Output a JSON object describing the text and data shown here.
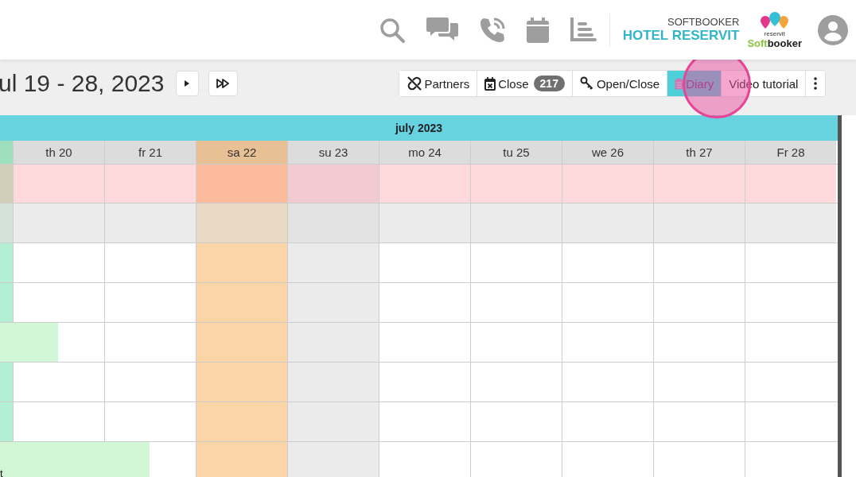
{
  "header": {
    "brand_top": "SOFTBOOKER",
    "brand_name": "HOTEL RESERVIT",
    "logo": {
      "small": "reservit",
      "first": "Soft",
      "second": "booker"
    }
  },
  "toolbar": {
    "period": "ul 19 - 28, 2023",
    "tabs": [
      {
        "label": "Partners",
        "selected": false
      },
      {
        "label": "Close",
        "badge": "217",
        "selected": false
      },
      {
        "label": "Open/Close",
        "selected": false
      },
      {
        "label": "Diary",
        "selected": true
      },
      {
        "label": "Video tutorial",
        "selected": false
      }
    ],
    "click_highlight": true
  },
  "calendar": {
    "month": "july 2023",
    "days": [
      {
        "label": "th 20",
        "kind": "weekday"
      },
      {
        "label": "fr 21",
        "kind": "weekday"
      },
      {
        "label": "sa 22",
        "kind": "saturday"
      },
      {
        "label": "su 23",
        "kind": "sunday"
      },
      {
        "label": "mo 24",
        "kind": "weekday"
      },
      {
        "label": "tu 25",
        "kind": "weekday"
      },
      {
        "label": "we 26",
        "kind": "weekday"
      },
      {
        "label": "th 27",
        "kind": "weekday"
      },
      {
        "label": "Fr 28",
        "kind": "weekday"
      }
    ],
    "rows": [
      {
        "kind": "price"
      },
      {
        "kind": "availability"
      },
      {
        "kind": "room",
        "booking": {
          "color": "#b3f0d3",
          "kind": "before_range"
        }
      },
      {
        "kind": "room",
        "booking": {
          "color": "#b3f0d3",
          "kind": "before_range"
        }
      },
      {
        "kind": "room",
        "booking": {
          "color": "#d1f7d6",
          "kind": "to_first_day"
        }
      },
      {
        "kind": "room",
        "booking": {
          "color": "#b3f0d3",
          "kind": "before_range"
        }
      },
      {
        "kind": "room",
        "booking": {
          "color": "#b3f0d3",
          "kind": "before_range"
        }
      },
      {
        "kind": "room",
        "booking": {
          "color": "#d1f7d6",
          "label": "t",
          "kind": "to_second_day"
        }
      }
    ]
  }
}
